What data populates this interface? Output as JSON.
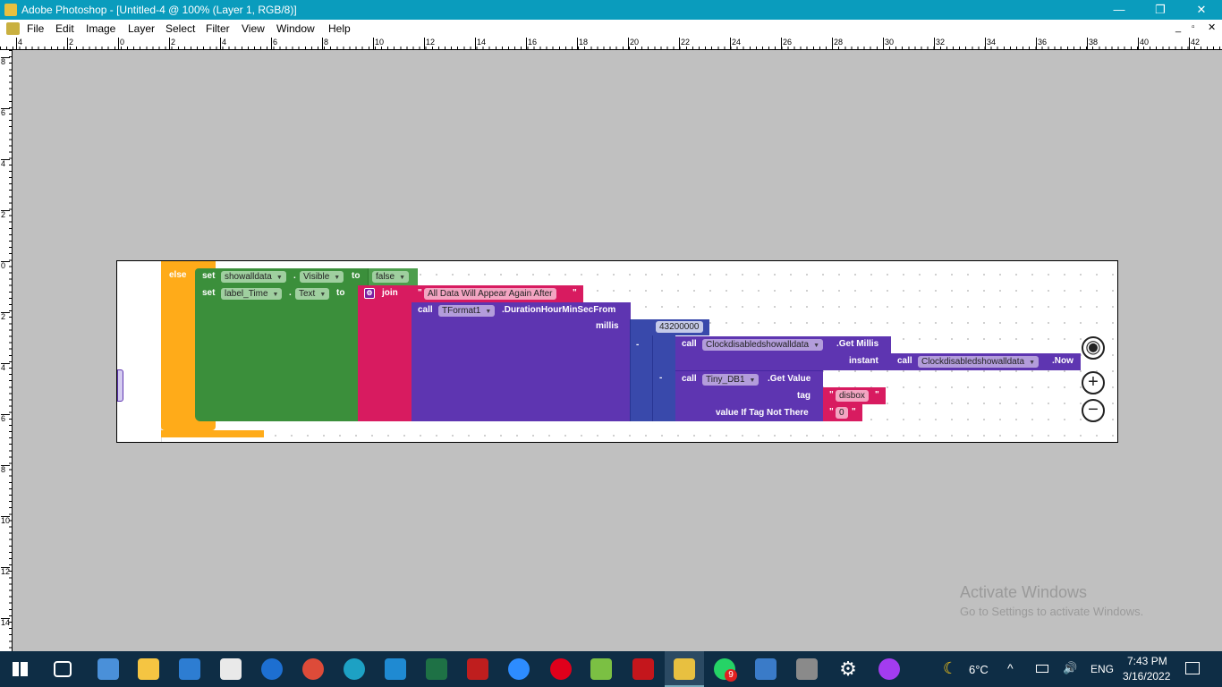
{
  "window": {
    "title": "Adobe Photoshop - [Untitled-4 @ 100% (Layer 1, RGB/8)]",
    "minimize": "—",
    "restore": "❐",
    "close": "✕"
  },
  "menu": [
    "File",
    "Edit",
    "Image",
    "Layer",
    "Select",
    "Filter",
    "View",
    "Window",
    "Help"
  ],
  "ruler": {
    "h": [
      "4",
      "2",
      "0",
      "2",
      "4",
      "6",
      "8",
      "10",
      "12",
      "14",
      "16",
      "18",
      "20",
      "22",
      "24",
      "26",
      "28",
      "30",
      "32",
      "34",
      "36",
      "38",
      "40",
      "42"
    ],
    "v": [
      "8",
      "6",
      "4",
      "2",
      "0",
      "2",
      "4",
      "6",
      "8",
      "10",
      "12",
      "14"
    ]
  },
  "blocks": {
    "else": "else",
    "set1": {
      "set": "set",
      "component": "showalldata",
      "prop": "Visible",
      "to": "to",
      "value": "false"
    },
    "set2": {
      "set": "set",
      "component": "label_Time",
      "prop": "Text",
      "to": "to"
    },
    "join": "join",
    "text1": "All Data Will Appear Again After",
    "quote": "\"",
    "tformat": {
      "call": "call",
      "component": "TFormat1",
      "method": ".DurationHourMinSecFrom",
      "param": "millis"
    },
    "number": "43200000",
    "minus": "-",
    "getmillis": {
      "call": "call",
      "component": "Clockdisabledshowalldata",
      "method": ".Get Millis",
      "param": "instant"
    },
    "now": {
      "call": "call",
      "component": "Clockdisabledshowalldata",
      "method": ".Now"
    },
    "tinydb": {
      "call": "call",
      "component": "Tiny_DB1",
      "method": ".Get Value",
      "tag": "tag",
      "tag_value": "disbox",
      "notthere": "value If Tag Not There",
      "notthere_value": "0"
    }
  },
  "colors": {
    "control": "#ffab19",
    "component": "#3b8f3b",
    "text": "#d81b60",
    "procedure": "#5e35b1",
    "math": "#3949ab"
  },
  "watermark": {
    "title": "Activate Windows",
    "sub": "Go to Settings to activate Windows."
  },
  "tray": {
    "weather": "6°C",
    "lang": "ENG",
    "time": "7:43 PM",
    "date": "3/16/2022",
    "whatsapp_badge": "9"
  }
}
